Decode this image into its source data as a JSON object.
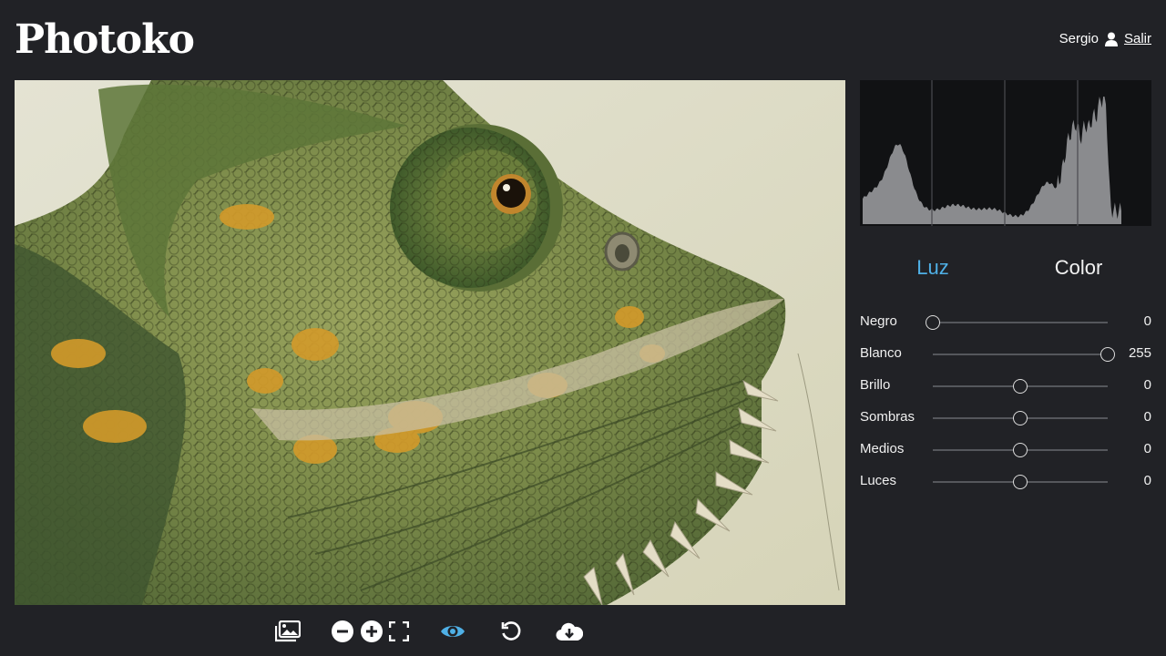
{
  "app": {
    "logo": "Photoko"
  },
  "user": {
    "name": "Sergio",
    "logout_label": "Salir",
    "icon": "user-icon"
  },
  "photo": {
    "subject": "chameleon-photo"
  },
  "toolbar": {
    "tools": [
      {
        "name": "image-gallery-icon",
        "active": false
      },
      {
        "name": "zoom-out-icon",
        "active": false
      },
      {
        "name": "zoom-in-icon",
        "active": false
      },
      {
        "name": "fit-to-screen-icon",
        "active": false
      },
      {
        "name": "preview-eye-icon",
        "active": true
      },
      {
        "name": "undo-icon",
        "active": false
      },
      {
        "name": "download-icon",
        "active": false
      }
    ]
  },
  "tabs": [
    {
      "label": "Luz",
      "active": true
    },
    {
      "label": "Color",
      "active": false
    }
  ],
  "sliders": [
    {
      "label": "Negro",
      "value": "0",
      "level": 0.0
    },
    {
      "label": "Blanco",
      "value": "255",
      "level": 1.0
    },
    {
      "label": "Brillo",
      "value": "0",
      "level": 0.5
    },
    {
      "label": "Sombras",
      "value": "0",
      "level": 0.5
    },
    {
      "label": "Medios",
      "value": "0",
      "level": 0.5
    },
    {
      "label": "Luces",
      "value": "0",
      "level": 0.5
    }
  ],
  "colors": {
    "accent": "#4fb0e6",
    "background": "#212226",
    "histogram_bg": "#111214",
    "histogram_fill": "#8a8b8e"
  }
}
